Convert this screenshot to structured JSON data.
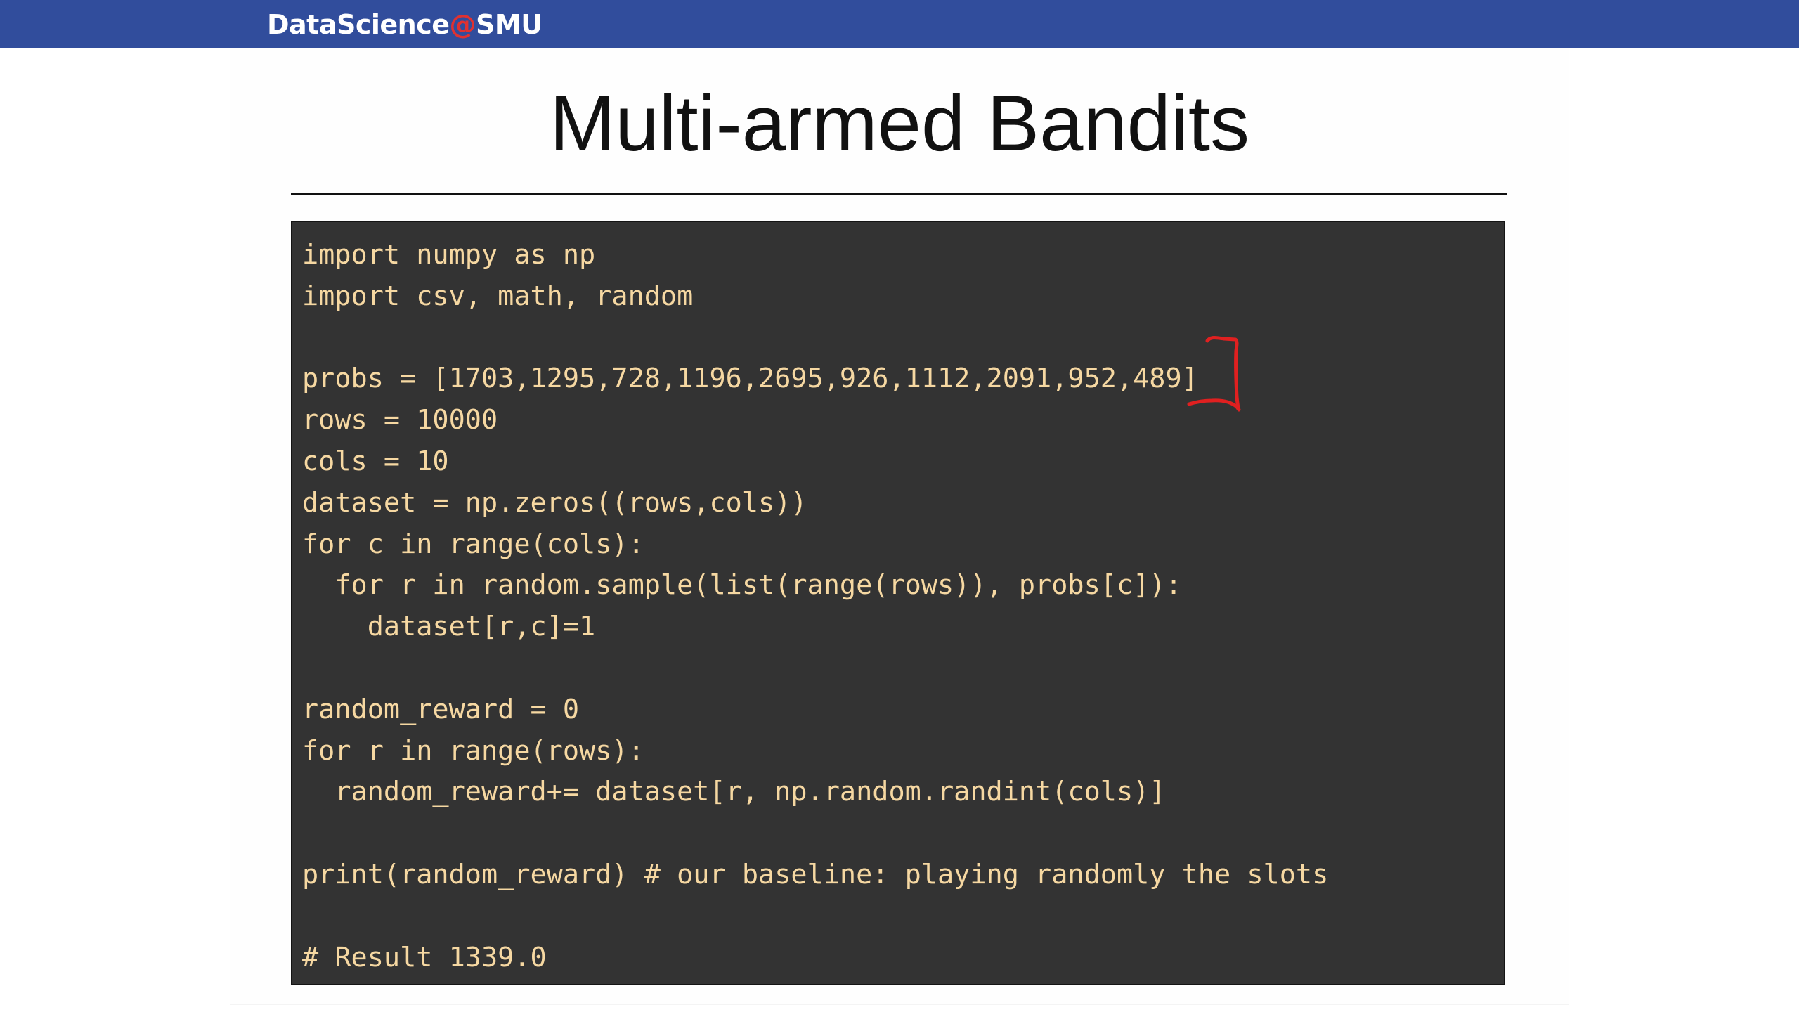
{
  "header": {
    "brand_main": "DataScience",
    "brand_at": "@",
    "brand_org": "SMU"
  },
  "slide": {
    "title": "Multi-armed Bandits",
    "code_lines": [
      "import numpy as np",
      "import csv, math, random",
      "",
      "probs = [1703,1295,728,1196,2695,926,1112,2091,952,489]",
      "rows = 10000",
      "cols = 10",
      "dataset = np.zeros((rows,cols))",
      "for c in range(cols):",
      "  for r in random.sample(list(range(rows)), probs[c]):",
      "    dataset[r,c]=1",
      "",
      "random_reward = 0",
      "for r in range(rows):",
      "  random_reward+= dataset[r, np.random.randint(cols)]",
      "",
      "print(random_reward) # our baseline: playing randomly the slots",
      "",
      "# Result 1339.0"
    ]
  },
  "colors": {
    "header_bg": "#314d9c",
    "brand_accent": "#e03131",
    "code_bg": "#333333",
    "code_text": "#f6d8a2",
    "annotation_ink": "#e02020"
  },
  "annotation": {
    "icon": "red-bracket-ink-mark"
  }
}
